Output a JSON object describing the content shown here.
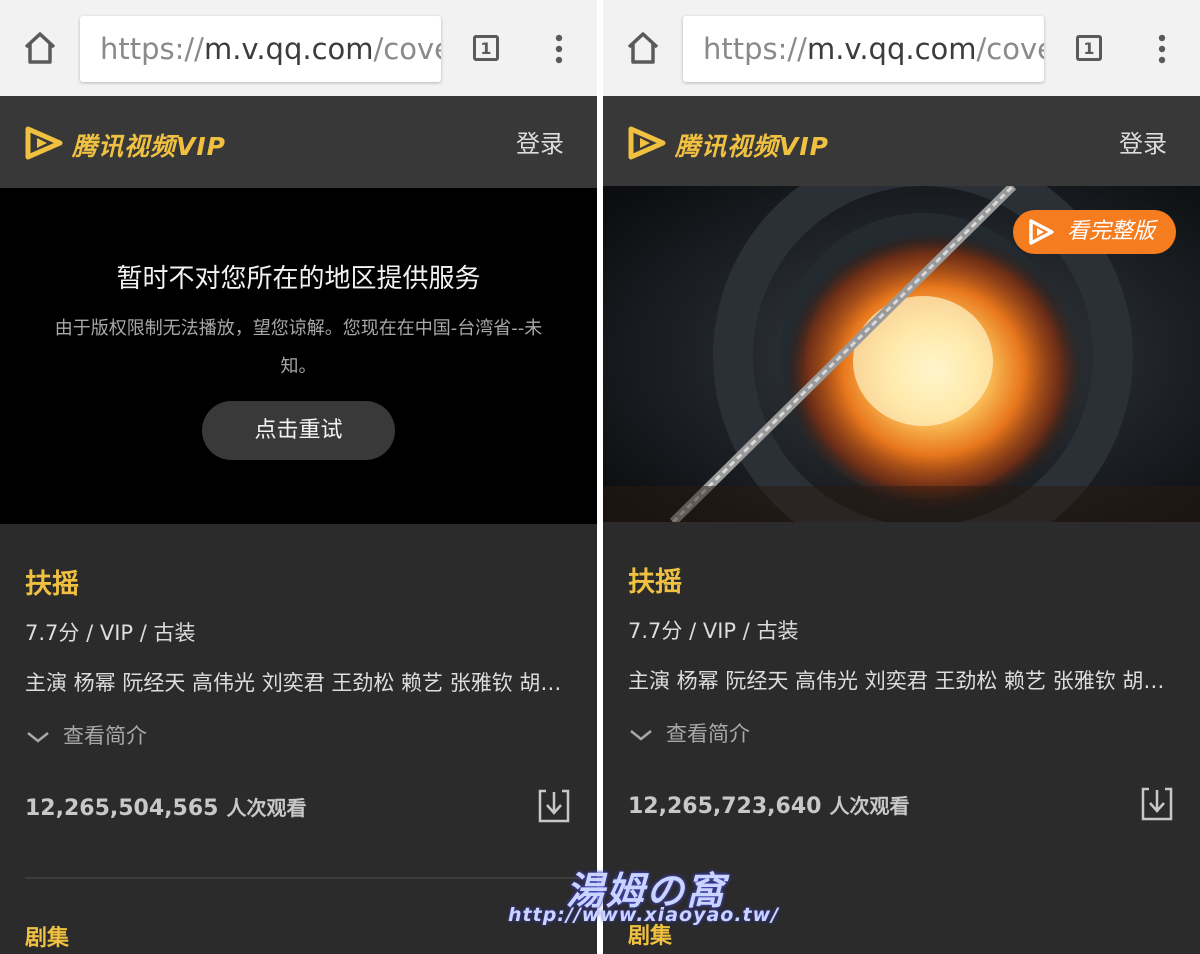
{
  "browser": {
    "url_scheme": "https://",
    "url_host": "m.v.qq.com",
    "url_path": "/cove",
    "tab_count": "1"
  },
  "site": {
    "logo_text": "腾讯视频VIP",
    "login_label": "登录"
  },
  "left": {
    "error_title": "暂时不对您所在的地区提供服务",
    "error_message": "由于版权限制无法播放，望您谅解。您现在在中国-台湾省--未知。",
    "retry_label": "点击重试",
    "show_title": "扶摇",
    "meta": "7.7分 / VIP / 古装",
    "cast": "主演 杨幂 阮经天 高伟光 刘奕君 王劲松 赖艺 张雅钦 胡…",
    "intro_label": "查看简介",
    "view_count": "12,265,504,565",
    "view_unit": "人次观看",
    "episodes_label": "剧集"
  },
  "right": {
    "watch_full_label": "看完整版",
    "show_title": "扶摇",
    "meta": "7.7分 / VIP / 古装",
    "cast": "主演 杨幂 阮经天 高伟光 刘奕君 王劲松 赖艺 张雅钦 胡…",
    "intro_label": "查看简介",
    "view_count": "12,265,723,640",
    "view_unit": "人次观看",
    "episodes_label": "剧集"
  },
  "watermark": {
    "text": "湯姆の窩",
    "url": "http://www.xiaoyao.tw/"
  },
  "colors": {
    "brand_gold": "#f0c040",
    "watch_full_orange": "#f57c1f",
    "page_bg": "#2b2b2b"
  },
  "icons": [
    "home-icon",
    "tabs-icon",
    "menu-icon",
    "tencent-video-logo-icon",
    "play-icon",
    "chevron-down-icon",
    "download-icon"
  ]
}
